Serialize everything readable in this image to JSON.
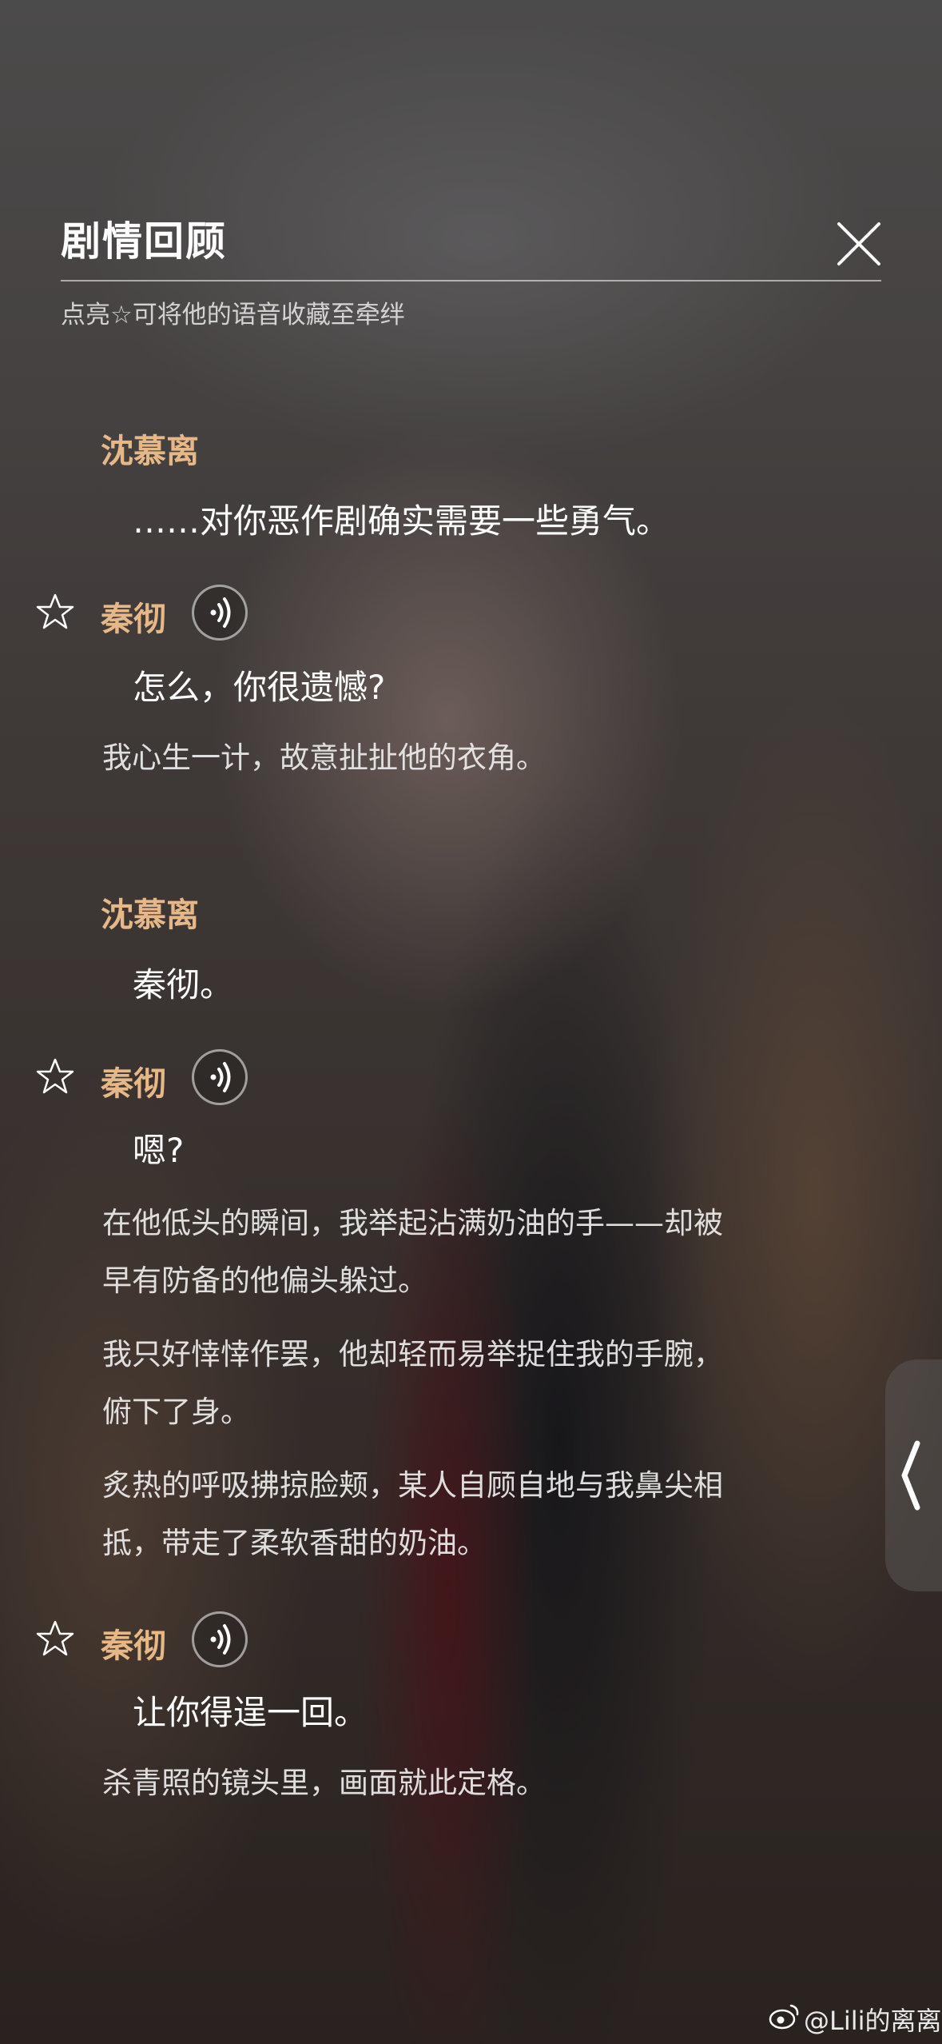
{
  "header": {
    "title": "剧情回顾",
    "subtitle": "点亮☆可将他的语音收藏至牵绊"
  },
  "dialogue": {
    "b1_name": "沈慕离",
    "b1_line": "……对你恶作剧确实需要一些勇气。",
    "b2_name": "秦彻",
    "b2_line": "怎么，你很遗憾?",
    "n1": "我心生一计，故意扯扯他的衣角。",
    "b3_name": "沈慕离",
    "b3_line": "秦彻。",
    "b4_name": "秦彻",
    "b4_line": "嗯?",
    "n2_l1": "在他低头的瞬间，我举起沾满奶油的手——却被",
    "n2_l2": "早有防备的他偏头躲过。",
    "n3_l1": "我只好悻悻作罢，他却轻而易举捉住我的手腕，",
    "n3_l2": "俯下了身。",
    "n4_l1": "炙热的呼吸拂掠脸颊，某人自顾自地与我鼻尖相",
    "n4_l2": "抵，带走了柔软香甜的奶油。",
    "b5_name": "秦彻",
    "b5_line": "让你得逞一回。",
    "n5": "杀青照的镜头里，画面就此定格。"
  },
  "watermark": "@Lili的离离",
  "icons": {
    "close": "close-icon",
    "star": "star-outline-icon",
    "voice": "voice-play-icon",
    "side_tab": "chevron-left-icon",
    "weibo": "weibo-logo-icon"
  },
  "colors": {
    "name": "#e7b887",
    "text": "#ffffff"
  }
}
